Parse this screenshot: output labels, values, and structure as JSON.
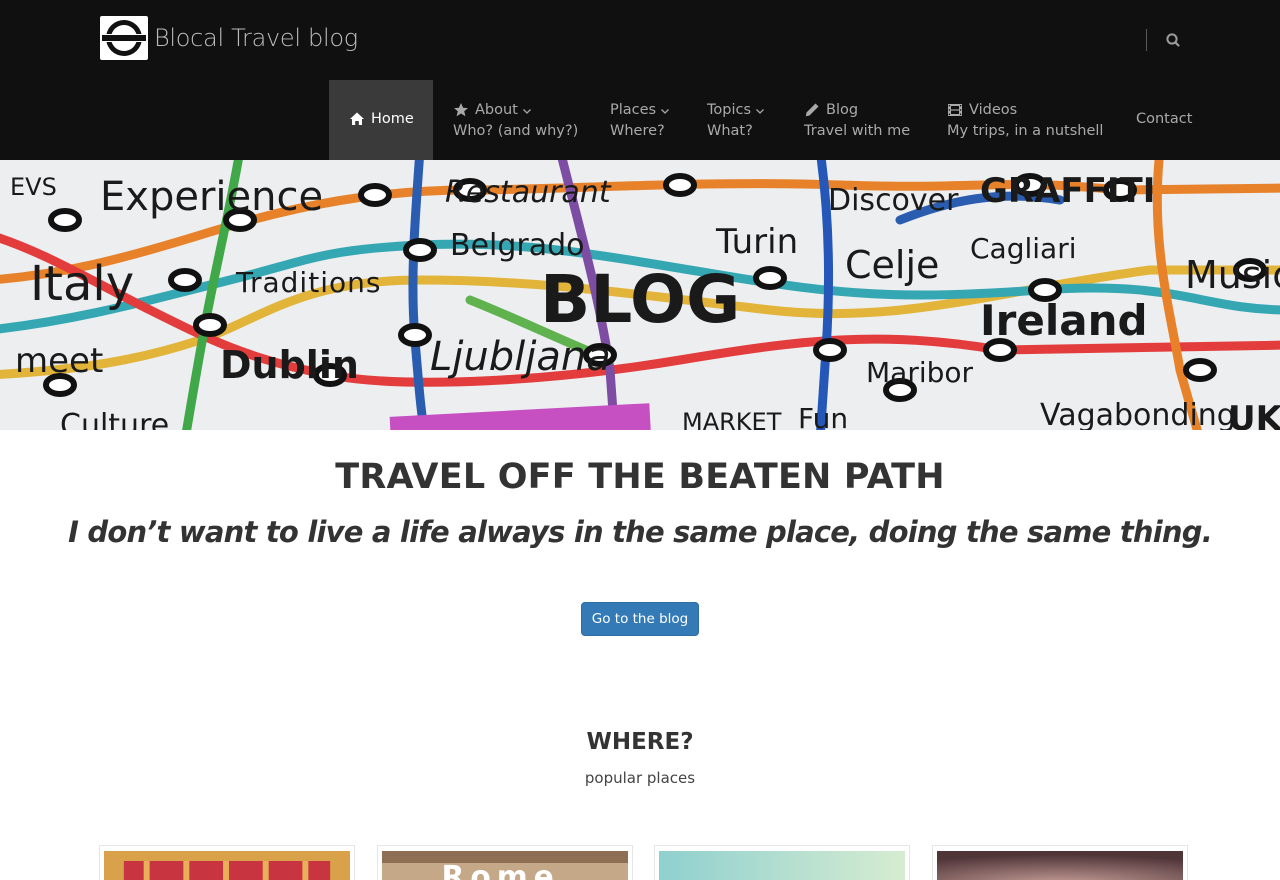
{
  "header": {
    "site_title": "Blocal Travel blog",
    "search_icon": "search-icon"
  },
  "nav": {
    "items": [
      {
        "icon": "home-icon",
        "label": "Home",
        "sub": "",
        "active": true
      },
      {
        "icon": "star-icon",
        "label": "About",
        "sub": "Who? (and why?)",
        "dropdown": true
      },
      {
        "icon": "",
        "label": "Places",
        "sub": "Where?",
        "dropdown": true
      },
      {
        "icon": "",
        "label": "Topics",
        "sub": "What?",
        "dropdown": true
      },
      {
        "icon": "pencil-icon",
        "label": "Blog",
        "sub": "Travel with me"
      },
      {
        "icon": "film-icon",
        "label": "Videos",
        "sub": "My trips, in a nutshell"
      },
      {
        "icon": "",
        "label": "Contact",
        "sub": ""
      }
    ]
  },
  "hero": {
    "words": [
      "EVS",
      "Experience",
      "Restaurant",
      "Discover",
      "GRAFFITI",
      "Belgrado",
      "Turin",
      "Celje",
      "Cagliari",
      "Music",
      "Italy",
      "Traditions",
      "BLOG",
      "Ireland",
      "meet",
      "Dublin",
      "Ljubljana",
      "Maribor",
      "Culture",
      "MARKET",
      "Fun",
      "Vagabonding",
      "UK"
    ]
  },
  "intro": {
    "title": "TRAVEL OFF THE BEATEN PATH",
    "quote": "I don’t want to live a life always in the same place, doing the same thing.",
    "cta_label": "Go to the blog"
  },
  "places": {
    "title": "WHERE?",
    "subtitle": "popular places",
    "cards": [
      {
        "label": "",
        "tone": "#d9a24a"
      },
      {
        "label": "Rome",
        "tone": "#b78f6a"
      },
      {
        "label": "",
        "tone": "#9fd3cf"
      },
      {
        "label": "",
        "tone": "#7a5650"
      }
    ]
  },
  "colors": {
    "header_bg": "#101010",
    "active_nav_bg": "#3a3a3a",
    "cta_bg": "#337ab7"
  }
}
